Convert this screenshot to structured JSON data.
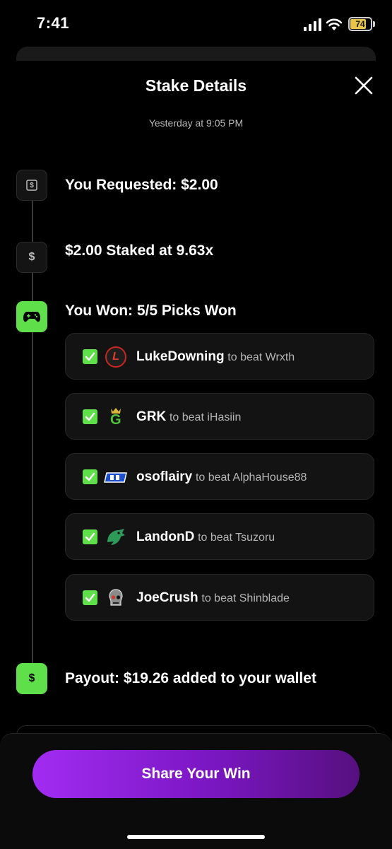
{
  "status_bar": {
    "time": "7:41",
    "battery": "74"
  },
  "header": {
    "title": "Stake Details",
    "subtitle": "Yesterday at 9:05 PM"
  },
  "steps": {
    "requested": {
      "title": "You Requested: $2.00",
      "icon": "dollar-bill-icon",
      "icon_glyph": "$"
    },
    "staked": {
      "title": "$2.00 Staked at 9.63x",
      "icon": "dollar-sign-icon",
      "icon_glyph": "$"
    },
    "won": {
      "title": "You Won: 5/5 Picks Won",
      "icon": "gamepad-icon"
    },
    "payout": {
      "title": "Payout: $19.26 added to your wallet",
      "icon": "dollar-sign-icon",
      "icon_glyph": "$"
    }
  },
  "picks": [
    {
      "player": "LukeDowning",
      "detail": "to beat Wrxth",
      "logo": "red-L-logo",
      "logo_glyph": "L"
    },
    {
      "player": "GRK",
      "detail": "to beat iHasiin",
      "logo": "green-crown-G-logo",
      "logo_glyph": "G"
    },
    {
      "player": "osoflairy",
      "detail": "to beat AlphaHouse88",
      "logo": "blue-badge-logo"
    },
    {
      "player": "LandonD",
      "detail": "to beat Tsuzoru",
      "logo": "green-dragon-logo"
    },
    {
      "player": "JoeCrush",
      "detail": "to beat Shinblade",
      "logo": "skull-logo"
    }
  ],
  "share_button": {
    "label": "Share Your Win"
  },
  "colors": {
    "accent_green": "#5fe04a",
    "button_purple": "#a22cf2"
  }
}
